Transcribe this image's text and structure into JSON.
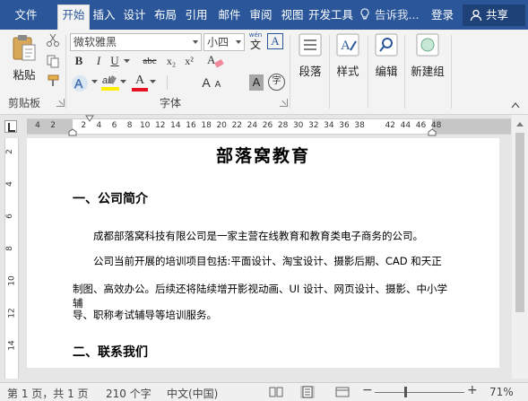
{
  "tabs": [
    "文件",
    "开始",
    "插入",
    "设计",
    "布局",
    "引用",
    "邮件",
    "审阅",
    "视图",
    "开发工具"
  ],
  "active_tab": "开始",
  "tell_me": "告诉我...",
  "login": "登录",
  "share": "共享",
  "clipboard": {
    "paste_label": "粘贴",
    "group_label": "剪贴板"
  },
  "font": {
    "name": "微软雅黑",
    "size": "小四",
    "group_label": "字体",
    "wen_label": "wén",
    "wen_char": "文",
    "bold": "B",
    "italic": "I",
    "underline": "U",
    "strike": "abc",
    "subscript": "x₂",
    "superscript": "x²",
    "font_color_letter": "A",
    "grow_font": "A",
    "shrink_font": "A",
    "char_shade": "A",
    "enclose_char": "字",
    "text_effect": "A",
    "border_char": "A",
    "accent_colors": {
      "highlight": "#ffef00",
      "font_color": "#e81123",
      "effect": "#4f81bd"
    }
  },
  "paragraph_label": "段落",
  "styles_label": "样式",
  "editing_label": "编辑",
  "new_group_label": "新建组",
  "ruler_numbers": [
    "4",
    "2",
    "",
    "2",
    "4",
    "6",
    "8",
    "10",
    "12",
    "14",
    "16",
    "18",
    "20",
    "22",
    "24",
    "26",
    "28",
    "30",
    "32",
    "34",
    "36",
    "38",
    "",
    "42",
    "44",
    "46",
    "48"
  ],
  "vruler_numbers": [
    "2",
    "4",
    "6",
    "8",
    "10",
    "12",
    "14"
  ],
  "document": {
    "title": "部落窝教育",
    "heading1": "一、公司简介",
    "para1": "成都部落窝科技有限公司是一家主营在线教育和教育类电子商务的公司。",
    "para2_line1": "公司当前开展的培训项目包括:平面设计、淘宝设计、摄影后期、CAD 和天正",
    "para2_line2": "制图、高效办公。后续还将陆续增开影视动画、UI 设计、网页设计、摄影、中小学辅",
    "para2_line3": "导、职称考试辅导等培训服务。",
    "heading2": "二、联系我们"
  },
  "status": {
    "page": "第 1 页，共 1 页",
    "words": "210 个字",
    "language": "中文(中国)",
    "zoom": "71%",
    "zoom_level_percent": 71,
    "minus": "−",
    "plus": "+"
  }
}
